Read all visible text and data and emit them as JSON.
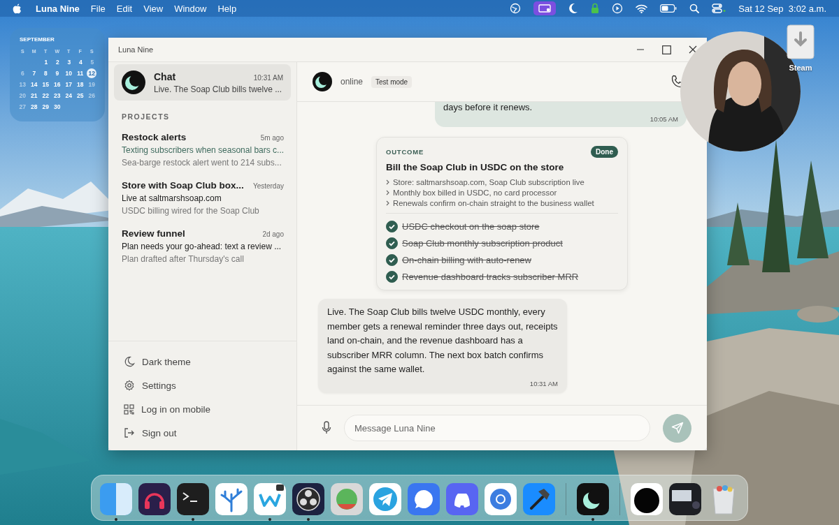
{
  "menubar": {
    "app": "Luna Nine",
    "menus": [
      "File",
      "Edit",
      "View",
      "Window",
      "Help"
    ],
    "clock": "Sat 12 Sep  3:02 a.m."
  },
  "calendar": {
    "month": "SEPTEMBER",
    "weekdays": [
      "S",
      "M",
      "T",
      "W",
      "T",
      "F",
      "S"
    ],
    "weeks": [
      [
        {
          "label": "1",
          "selected": false
        },
        {
          "label": "2",
          "selected": false
        },
        {
          "label": "3",
          "selected": false
        },
        {
          "label": "4",
          "selected": false
        },
        {
          "label": "5",
          "selected": false
        }
      ],
      [
        {
          "label": "6",
          "selected": false
        },
        {
          "label": "7",
          "selected": false
        },
        {
          "label": "8",
          "selected": false
        },
        {
          "label": "9",
          "selected": false
        },
        {
          "label": "10",
          "selected": false
        },
        {
          "label": "11",
          "selected": false
        },
        {
          "label": "12",
          "selected": true
        }
      ],
      [
        {
          "label": "13",
          "selected": false
        },
        {
          "label": "14",
          "selected": false
        },
        {
          "label": "15",
          "selected": false
        },
        {
          "label": "16",
          "selected": false
        },
        {
          "label": "17",
          "selected": false
        },
        {
          "label": "18",
          "selected": false
        },
        {
          "label": "19",
          "selected": false
        }
      ],
      [
        {
          "label": "20",
          "selected": false
        },
        {
          "label": "21",
          "selected": false
        },
        {
          "label": "22",
          "selected": false
        },
        {
          "label": "23",
          "selected": false
        },
        {
          "label": "24",
          "selected": false
        },
        {
          "label": "25",
          "selected": false
        },
        {
          "label": "26",
          "selected": false
        }
      ],
      [
        {
          "label": "27",
          "selected": false
        },
        {
          "label": "28",
          "selected": false
        },
        {
          "label": "29",
          "selected": false
        },
        {
          "label": "30",
          "selected": false
        }
      ]
    ]
  },
  "desktop_icons": [
    {
      "kind": "download",
      "label": "Steam"
    }
  ],
  "window": {
    "title": "Luna Nine",
    "sidebar": {
      "chat": {
        "title": "Chat",
        "time": "10:31 AM",
        "preview": "Live. The Soap Club bills twelve ...",
        "selected": true
      },
      "projects_heading": "PROJECTS",
      "projects": [
        {
          "title": "Restock alerts",
          "time": "5m ago",
          "summary": "Texting subscribers when seasonal bars c...",
          "color": "#3f6b5e",
          "detail": "Sea-barge restock alert went to 214 subs..."
        },
        {
          "title": "Store with Soap Club box...",
          "time": "Yesterday",
          "summary": "Live at saltmarshsoap.com",
          "color": "#222222",
          "detail": "USDC billing wired for the Soap Club"
        },
        {
          "title": "Review funnel",
          "time": "2d ago",
          "summary": "Plan needs your go-ahead: text a review ...",
          "color": "#222222",
          "detail": "Plan drafted after Thursday's call"
        }
      ],
      "footer": [
        {
          "kind": "theme",
          "label": "Dark theme"
        },
        {
          "kind": "settings",
          "label": "Settings"
        },
        {
          "kind": "qr",
          "label": "Log in on mobile"
        },
        {
          "kind": "signout",
          "label": "Sign out"
        }
      ]
    },
    "chat_header": {
      "status": "online",
      "badge": "Test mode"
    },
    "messages": [
      {
        "kind": "user",
        "text": "days before it renews.",
        "time": "10:05 AM"
      },
      {
        "kind": "outcome",
        "label": "OUTCOME",
        "badge": "Done",
        "title": "Bill the Soap Club in USDC on the store",
        "bullets": [
          "Store: saltmarshsoap.com, Soap Club subscription live",
          "Monthly box billed in USDC, no card processor",
          "Renewals confirm on-chain straight to the business wallet"
        ],
        "checklist": [
          {
            "text": "USDC checkout on the soap store",
            "done": true
          },
          {
            "text": "Soap Club monthly subscription product",
            "done": true
          },
          {
            "text": "On-chain billing with auto-renew",
            "done": true
          },
          {
            "text": "Revenue dashboard tracks subscriber MRR",
            "done": true
          }
        ]
      },
      {
        "kind": "assistant",
        "text": "Live. The Soap Club bills twelve USDC monthly, every member gets a renewal reminder three days out, receipts land on-chain, and the revenue dashboard has a subscriber MRR column. The next box batch confirms against the same wallet.",
        "time": "10:31 AM"
      }
    ],
    "composer": {
      "placeholder": "Message Luna Nine",
      "send_disabled": true
    }
  },
  "dock": {
    "groups": [
      [
        {
          "kind": "finder",
          "running": true
        },
        {
          "kind": "podcast",
          "running": false
        },
        {
          "kind": "terminal",
          "running": true
        },
        {
          "kind": "coral",
          "running": false
        },
        {
          "kind": "wave",
          "running": true
        },
        {
          "kind": "obs",
          "running": true
        },
        {
          "kind": "reaper",
          "running": false
        },
        {
          "kind": "telegram",
          "running": false
        },
        {
          "kind": "signal",
          "running": false
        },
        {
          "kind": "discord",
          "running": false
        },
        {
          "kind": "browser",
          "running": false
        },
        {
          "kind": "hammer",
          "running": false
        }
      ],
      [
        {
          "kind": "luna",
          "running": true
        }
      ],
      [
        {
          "kind": "window-disc",
          "running": false
        },
        {
          "kind": "window-thumb",
          "running": false
        },
        {
          "kind": "trash",
          "running": false
        }
      ]
    ]
  }
}
